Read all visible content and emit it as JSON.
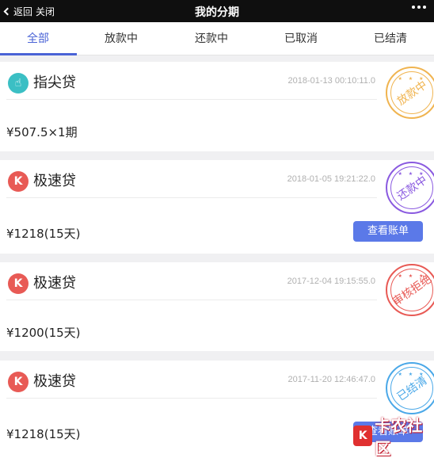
{
  "topbar": {
    "back_label": "返回",
    "close_label": "关闭",
    "title": "我的分期"
  },
  "tabs": [
    {
      "label": "全部",
      "active": true
    },
    {
      "label": "放款中",
      "active": false
    },
    {
      "label": "还款中",
      "active": false
    },
    {
      "label": "已取消",
      "active": false
    },
    {
      "label": "已结清",
      "active": false
    }
  ],
  "loans": [
    {
      "product": "指尖贷",
      "icon": "finger-tap-icon",
      "icon_color": "#3bbfc4",
      "date": "2018-01-13 00:10:11.0",
      "amount": "¥507.5×1期",
      "stamp": "放款中",
      "stamp_color": "#f0b450",
      "show_bill": false
    },
    {
      "product": "极速贷",
      "icon": "lightning-k-icon",
      "icon_color": "#e85a55",
      "date": "2018-01-05 19:21:22.0",
      "amount": "¥1218(15天)",
      "stamp": "还款中",
      "stamp_color": "#8a5ae0",
      "show_bill": true
    },
    {
      "product": "极速贷",
      "icon": "lightning-k-icon",
      "icon_color": "#e85a55",
      "date": "2017-12-04 19:15:55.0",
      "amount": "¥1200(15天)",
      "stamp": "审核拒绝",
      "stamp_color": "#e85a55",
      "show_bill": false
    },
    {
      "product": "极速贷",
      "icon": "lightning-k-icon",
      "icon_color": "#e85a55",
      "date": "2017-11-20 12:46:47.0",
      "amount": "¥1218(15天)",
      "stamp": "已结清",
      "stamp_color": "#4aa8e8",
      "show_bill": true
    }
  ],
  "bill_button_label": "查看账单",
  "watermark": {
    "text": "卡农社区",
    "logo": "K"
  }
}
